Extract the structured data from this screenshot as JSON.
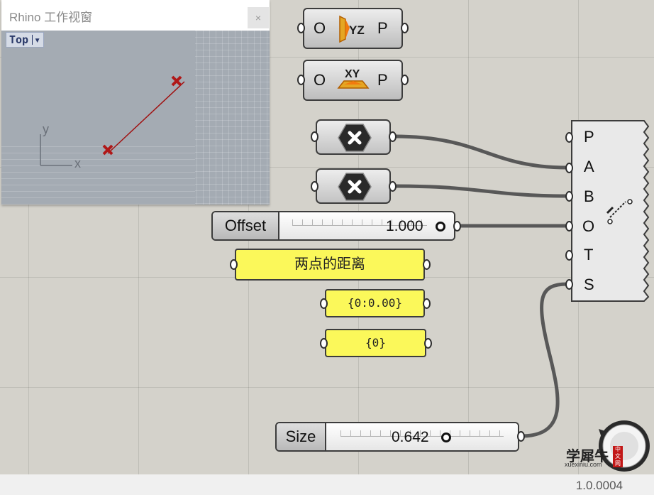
{
  "rhino_window": {
    "title": "Rhino 工作视窗",
    "close_label": "×",
    "viewport_name": "Top",
    "viewport_menu_arrow": "▾",
    "axis_x": "x",
    "axis_y": "y",
    "point_color": "#b01818",
    "line_color": "#a01010"
  },
  "components": {
    "yz_plane": {
      "input": "O",
      "output": "P",
      "icon_label": "YZ"
    },
    "xy_plane": {
      "input": "O",
      "output": "P",
      "icon_label": "XY"
    },
    "point_param_1": {
      "icon": "x-hexagon-icon"
    },
    "point_param_2": {
      "icon": "x-hexagon-icon"
    },
    "line_component": {
      "inputs": [
        "P",
        "A",
        "B",
        "O",
        "T",
        "S"
      ],
      "icon": "dimension-line-icon"
    }
  },
  "sliders": {
    "offset": {
      "name": "Offset",
      "value": "1.000",
      "fraction": 1.0
    },
    "size": {
      "name": "Size",
      "value": "0.642",
      "fraction": 0.642
    }
  },
  "panels": {
    "text_panel": "两点的距离",
    "distance_panel": "{0:0.00}",
    "path_panel": "{0}"
  },
  "statusbar": {
    "version": "1.0.0004"
  },
  "watermark": {
    "text": "学犀牛",
    "url": "xuexiniu.com",
    "seal": "中文网"
  },
  "colors": {
    "canvas": "#d4d2cb",
    "panel": "#fbf85a",
    "wire": "#585858"
  }
}
